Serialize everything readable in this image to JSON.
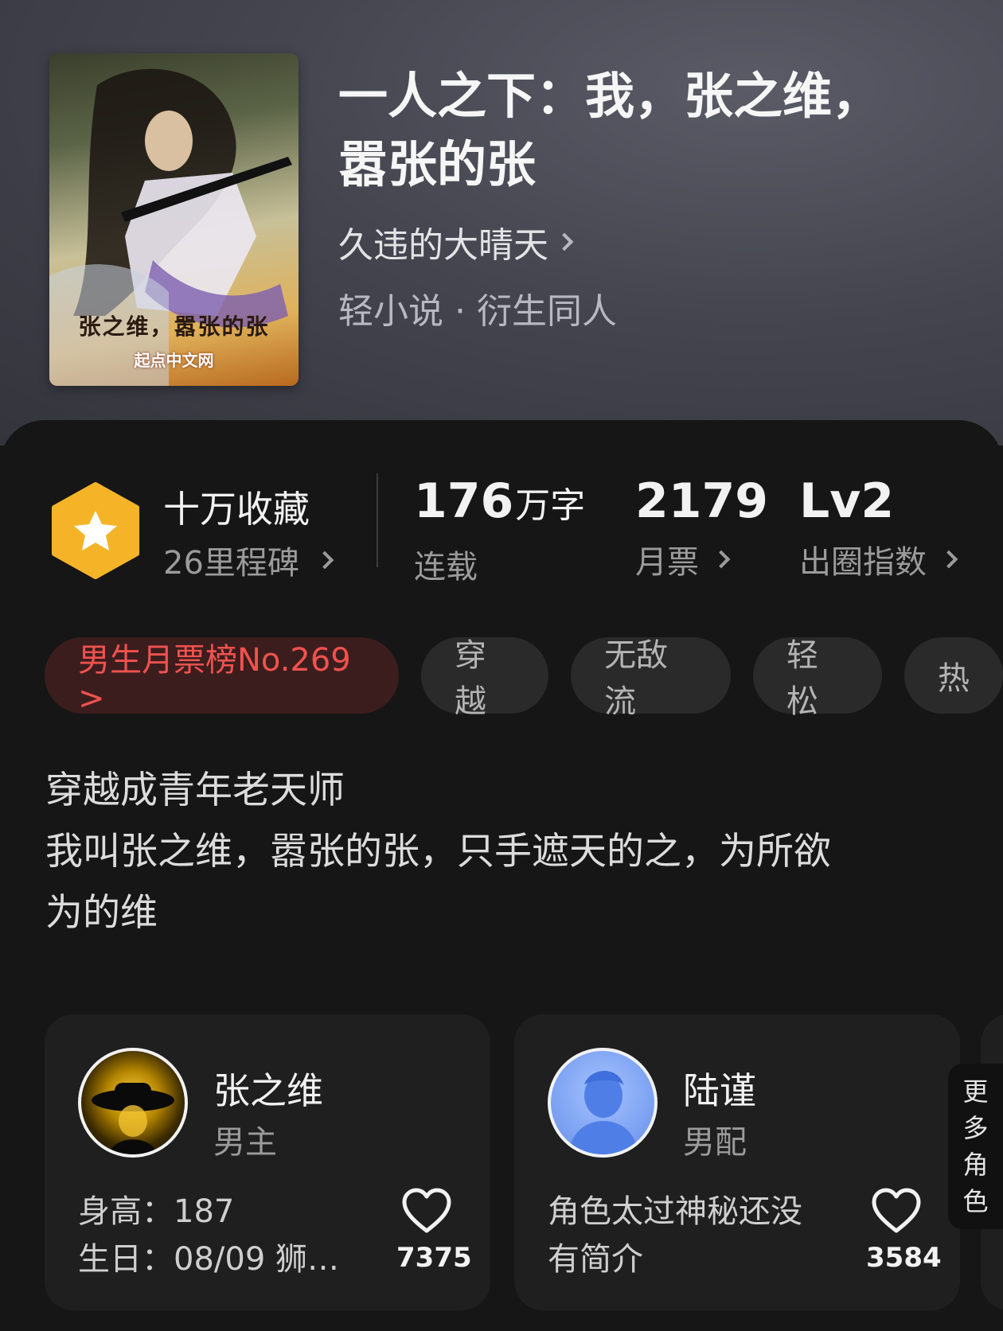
{
  "book": {
    "title_line1": "一人之下：我，张之维，",
    "title_line2": "嚣张的张",
    "author": "久违的大晴天",
    "genre": "轻小说 · 衍生同人",
    "cover_text": "张之维，嚣张的张",
    "cover_publisher": "起点中文网"
  },
  "stats": {
    "collect_title": "十万收藏",
    "collect_sub": "26里程碑",
    "words_num": "176",
    "words_unit": "万字",
    "words_label": "连载",
    "tickets_num": "2179",
    "tickets_label": "月票",
    "level_num": "Lv2",
    "level_label": "出圈指数"
  },
  "tags": [
    "男生月票榜No.269 >",
    "穿越",
    "无敌流",
    "轻松",
    "热"
  ],
  "synopsis": [
    "穿越成青年老天师",
    "我叫张之维，嚣张的张，只手遮天的之，为所欲",
    "为的维"
  ],
  "roles": [
    {
      "name": "张之维",
      "type": "男主",
      "desc_line1": "身高：187",
      "desc_line2": "生日：08/09 狮…",
      "likes": "7375"
    },
    {
      "name": "陆谨",
      "type": "男配",
      "desc_line1": "角色太过神秘还没",
      "desc_line2": "有简介",
      "likes": "3584"
    }
  ],
  "more_roles": [
    "更",
    "多",
    "角",
    "色"
  ],
  "colors": {
    "rank_text": "#f0524f",
    "rank_bg": "#3c1d1d",
    "badge": "#f5b428"
  }
}
